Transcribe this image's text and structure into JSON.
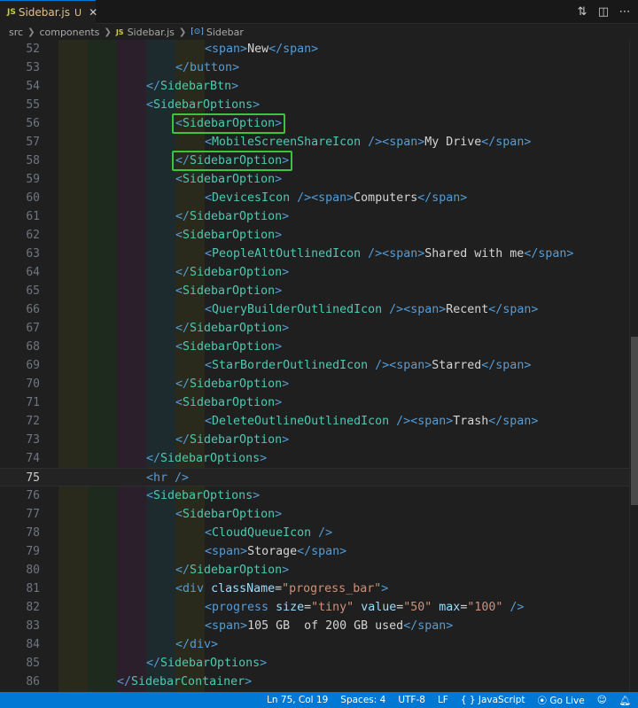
{
  "tab": {
    "icon": "js-file-icon",
    "badge": "JS",
    "label": "Sidebar.js",
    "status": "U",
    "close": "✕"
  },
  "breadcrumb": [
    "src",
    "components",
    "Sidebar.js",
    "Sidebar"
  ],
  "lines": [
    {
      "n": "52",
      "indent": 5,
      "tokens": [
        [
          "html",
          "<"
        ],
        [
          "html",
          "span"
        ],
        [
          "html",
          ">"
        ],
        [
          "text",
          "New"
        ],
        [
          "html",
          "</"
        ],
        [
          "html",
          "span"
        ],
        [
          "html",
          ">"
        ]
      ]
    },
    {
      "n": "53",
      "indent": 4,
      "tokens": [
        [
          "html",
          "</"
        ],
        [
          "html",
          "button"
        ],
        [
          "html",
          ">"
        ]
      ]
    },
    {
      "n": "54",
      "indent": 3,
      "tokens": [
        [
          "html",
          "</"
        ],
        [
          "tag",
          "SidebarBtn"
        ],
        [
          "html",
          ">"
        ]
      ]
    },
    {
      "n": "55",
      "indent": 3,
      "tokens": [
        [
          "html",
          "<"
        ],
        [
          "tag",
          "SidebarOptions"
        ],
        [
          "html",
          ">"
        ]
      ]
    },
    {
      "n": "56",
      "indent": 4,
      "tokens": [
        [
          "html",
          "<"
        ],
        [
          "tag",
          "SidebarOption"
        ],
        [
          "html",
          ">"
        ]
      ]
    },
    {
      "n": "57",
      "indent": 5,
      "tokens": [
        [
          "html",
          "<"
        ],
        [
          "tag",
          "MobileScreenShareIcon"
        ],
        [
          "text",
          " "
        ],
        [
          "html",
          "/>"
        ],
        [
          "html",
          "<"
        ],
        [
          "html",
          "span"
        ],
        [
          "html",
          ">"
        ],
        [
          "text",
          "My Drive"
        ],
        [
          "html",
          "</"
        ],
        [
          "html",
          "span"
        ],
        [
          "html",
          ">"
        ]
      ]
    },
    {
      "n": "58",
      "indent": 4,
      "tokens": [
        [
          "html",
          "</"
        ],
        [
          "tag",
          "SidebarOption"
        ],
        [
          "html",
          ">"
        ]
      ]
    },
    {
      "n": "59",
      "indent": 4,
      "tokens": [
        [
          "html",
          "<"
        ],
        [
          "tag",
          "SidebarOption"
        ],
        [
          "html",
          ">"
        ]
      ]
    },
    {
      "n": "60",
      "indent": 5,
      "tokens": [
        [
          "html",
          "<"
        ],
        [
          "tag",
          "DevicesIcon"
        ],
        [
          "text",
          " "
        ],
        [
          "html",
          "/>"
        ],
        [
          "html",
          "<"
        ],
        [
          "html",
          "span"
        ],
        [
          "html",
          ">"
        ],
        [
          "text",
          "Computers"
        ],
        [
          "html",
          "</"
        ],
        [
          "html",
          "span"
        ],
        [
          "html",
          ">"
        ]
      ]
    },
    {
      "n": "61",
      "indent": 4,
      "tokens": [
        [
          "html",
          "</"
        ],
        [
          "tag",
          "SidebarOption"
        ],
        [
          "html",
          ">"
        ]
      ]
    },
    {
      "n": "62",
      "indent": 4,
      "tokens": [
        [
          "html",
          "<"
        ],
        [
          "tag",
          "SidebarOption"
        ],
        [
          "html",
          ">"
        ]
      ]
    },
    {
      "n": "63",
      "indent": 5,
      "tokens": [
        [
          "html",
          "<"
        ],
        [
          "tag",
          "PeopleAltOutlinedIcon"
        ],
        [
          "text",
          " "
        ],
        [
          "html",
          "/>"
        ],
        [
          "html",
          "<"
        ],
        [
          "html",
          "span"
        ],
        [
          "html",
          ">"
        ],
        [
          "text",
          "Shared with me"
        ],
        [
          "html",
          "</"
        ],
        [
          "html",
          "span"
        ],
        [
          "html",
          ">"
        ]
      ]
    },
    {
      "n": "64",
      "indent": 4,
      "tokens": [
        [
          "html",
          "</"
        ],
        [
          "tag",
          "SidebarOption"
        ],
        [
          "html",
          ">"
        ]
      ]
    },
    {
      "n": "65",
      "indent": 4,
      "tokens": [
        [
          "html",
          "<"
        ],
        [
          "tag",
          "SidebarOption"
        ],
        [
          "html",
          ">"
        ]
      ]
    },
    {
      "n": "66",
      "indent": 5,
      "tokens": [
        [
          "html",
          "<"
        ],
        [
          "tag",
          "QueryBuilderOutlinedIcon"
        ],
        [
          "text",
          " "
        ],
        [
          "html",
          "/>"
        ],
        [
          "html",
          "<"
        ],
        [
          "html",
          "span"
        ],
        [
          "html",
          ">"
        ],
        [
          "text",
          "Recent"
        ],
        [
          "html",
          "</"
        ],
        [
          "html",
          "span"
        ],
        [
          "html",
          ">"
        ]
      ]
    },
    {
      "n": "67",
      "indent": 4,
      "tokens": [
        [
          "html",
          "</"
        ],
        [
          "tag",
          "SidebarOption"
        ],
        [
          "html",
          ">"
        ]
      ]
    },
    {
      "n": "68",
      "indent": 4,
      "tokens": [
        [
          "html",
          "<"
        ],
        [
          "tag",
          "SidebarOption"
        ],
        [
          "html",
          ">"
        ]
      ]
    },
    {
      "n": "69",
      "indent": 5,
      "tokens": [
        [
          "html",
          "<"
        ],
        [
          "tag",
          "StarBorderOutlinedIcon"
        ],
        [
          "text",
          " "
        ],
        [
          "html",
          "/>"
        ],
        [
          "html",
          "<"
        ],
        [
          "html",
          "span"
        ],
        [
          "html",
          ">"
        ],
        [
          "text",
          "Starred"
        ],
        [
          "html",
          "</"
        ],
        [
          "html",
          "span"
        ],
        [
          "html",
          ">"
        ]
      ]
    },
    {
      "n": "70",
      "indent": 4,
      "tokens": [
        [
          "html",
          "</"
        ],
        [
          "tag",
          "SidebarOption"
        ],
        [
          "html",
          ">"
        ]
      ]
    },
    {
      "n": "71",
      "indent": 4,
      "tokens": [
        [
          "html",
          "<"
        ],
        [
          "tag",
          "SidebarOption"
        ],
        [
          "html",
          ">"
        ]
      ]
    },
    {
      "n": "72",
      "indent": 5,
      "tokens": [
        [
          "html",
          "<"
        ],
        [
          "tag",
          "DeleteOutlineOutlinedIcon"
        ],
        [
          "text",
          " "
        ],
        [
          "html",
          "/>"
        ],
        [
          "html",
          "<"
        ],
        [
          "html",
          "span"
        ],
        [
          "html",
          ">"
        ],
        [
          "text",
          "Trash"
        ],
        [
          "html",
          "</"
        ],
        [
          "html",
          "span"
        ],
        [
          "html",
          ">"
        ]
      ]
    },
    {
      "n": "73",
      "indent": 4,
      "tokens": [
        [
          "html",
          "</"
        ],
        [
          "tag",
          "SidebarOption"
        ],
        [
          "html",
          ">"
        ]
      ]
    },
    {
      "n": "74",
      "indent": 3,
      "tokens": [
        [
          "html",
          "</"
        ],
        [
          "tag",
          "SidebarOptions"
        ],
        [
          "html",
          ">"
        ]
      ]
    },
    {
      "n": "75",
      "indent": 3,
      "current": true,
      "tokens": [
        [
          "html",
          "<"
        ],
        [
          "html",
          "hr"
        ],
        [
          "text",
          " "
        ],
        [
          "html",
          "/>"
        ]
      ]
    },
    {
      "n": "76",
      "indent": 3,
      "tokens": [
        [
          "html",
          "<"
        ],
        [
          "tag",
          "SidebarOptions"
        ],
        [
          "html",
          ">"
        ]
      ]
    },
    {
      "n": "77",
      "indent": 4,
      "tokens": [
        [
          "html",
          "<"
        ],
        [
          "tag",
          "SidebarOption"
        ],
        [
          "html",
          ">"
        ]
      ]
    },
    {
      "n": "78",
      "indent": 5,
      "tokens": [
        [
          "html",
          "<"
        ],
        [
          "tag",
          "CloudQueueIcon"
        ],
        [
          "text",
          " "
        ],
        [
          "html",
          "/>"
        ]
      ]
    },
    {
      "n": "79",
      "indent": 5,
      "tokens": [
        [
          "html",
          "<"
        ],
        [
          "html",
          "span"
        ],
        [
          "html",
          ">"
        ],
        [
          "text",
          "Storage"
        ],
        [
          "html",
          "</"
        ],
        [
          "html",
          "span"
        ],
        [
          "html",
          ">"
        ]
      ]
    },
    {
      "n": "80",
      "indent": 4,
      "tokens": [
        [
          "html",
          "</"
        ],
        [
          "tag",
          "SidebarOption"
        ],
        [
          "html",
          ">"
        ]
      ]
    },
    {
      "n": "81",
      "indent": 4,
      "tokens": [
        [
          "html",
          "<"
        ],
        [
          "html",
          "div"
        ],
        [
          "text",
          " "
        ],
        [
          "attr",
          "className"
        ],
        [
          "eq",
          "="
        ],
        [
          "str",
          "\"progress_bar\""
        ],
        [
          "html",
          ">"
        ]
      ]
    },
    {
      "n": "82",
      "indent": 5,
      "tokens": [
        [
          "html",
          "<"
        ],
        [
          "html",
          "progress"
        ],
        [
          "text",
          " "
        ],
        [
          "attr",
          "size"
        ],
        [
          "eq",
          "="
        ],
        [
          "str",
          "\"tiny\""
        ],
        [
          "text",
          " "
        ],
        [
          "attr",
          "value"
        ],
        [
          "eq",
          "="
        ],
        [
          "str",
          "\"50\""
        ],
        [
          "text",
          " "
        ],
        [
          "attr",
          "max"
        ],
        [
          "eq",
          "="
        ],
        [
          "str",
          "\"100\""
        ],
        [
          "text",
          " "
        ],
        [
          "html",
          "/>"
        ]
      ]
    },
    {
      "n": "83",
      "indent": 5,
      "tokens": [
        [
          "html",
          "<"
        ],
        [
          "html",
          "span"
        ],
        [
          "html",
          ">"
        ],
        [
          "text",
          "105 GB  of 200 GB used"
        ],
        [
          "html",
          "</"
        ],
        [
          "html",
          "span"
        ],
        [
          "html",
          ">"
        ]
      ]
    },
    {
      "n": "84",
      "indent": 4,
      "tokens": [
        [
          "html",
          "</"
        ],
        [
          "html",
          "div"
        ],
        [
          "html",
          ">"
        ]
      ]
    },
    {
      "n": "85",
      "indent": 3,
      "tokens": [
        [
          "html",
          "</"
        ],
        [
          "tag",
          "SidebarOptions"
        ],
        [
          "html",
          ">"
        ]
      ]
    },
    {
      "n": "86",
      "indent": 2,
      "tokens": [
        [
          "html",
          "</"
        ],
        [
          "tag",
          "SidebarContainer"
        ],
        [
          "html",
          ">"
        ]
      ]
    }
  ],
  "highlighted_lines": [
    "56",
    "58"
  ],
  "status": {
    "position": "Ln 75, Col 19",
    "spaces": "Spaces: 4",
    "encoding": "UTF-8",
    "eol": "LF",
    "language_icon": "{ }",
    "language": "JavaScript",
    "golive_icon": "broadcast-icon",
    "golive": "Go Live",
    "feedback_icon": "person-feedback-icon",
    "bell_icon": "bell-icon"
  },
  "colors": {
    "accent": "#0078d4",
    "highlight_box": "#3cc43c",
    "tag": "#4ec9b0",
    "html": "#569cd6",
    "attr": "#9cdcfe",
    "string": "#ce9178"
  }
}
